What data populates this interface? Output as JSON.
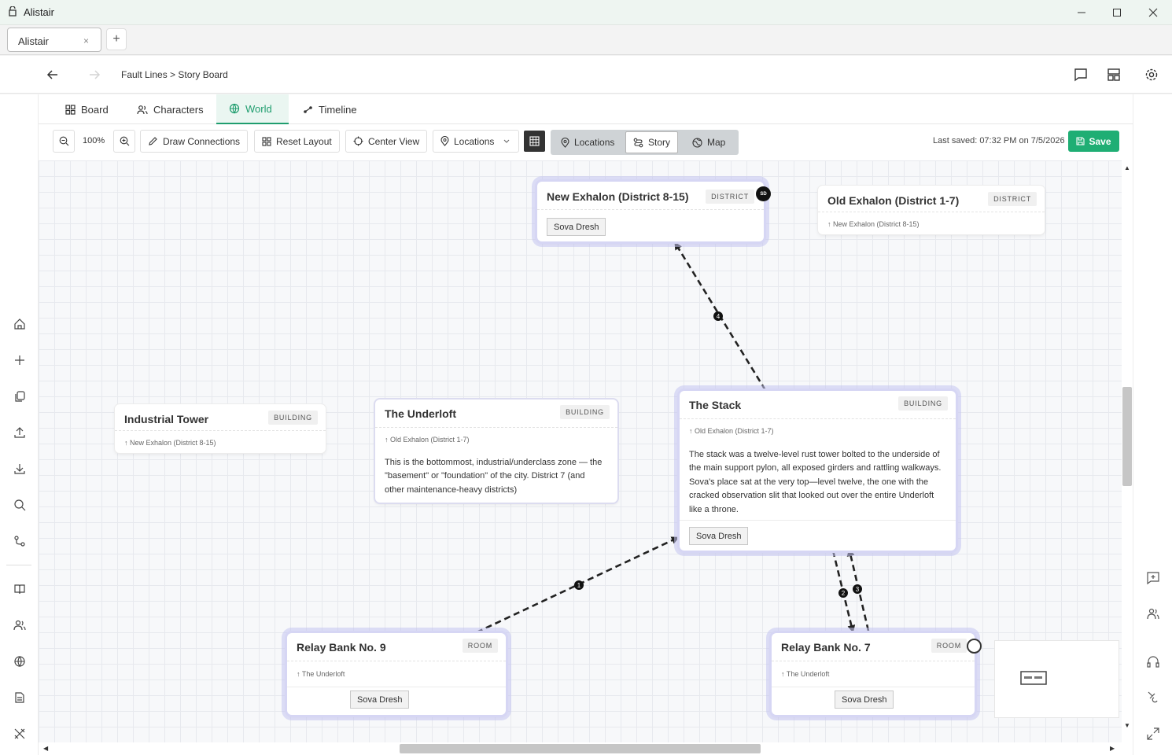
{
  "window": {
    "title": "Alistair"
  },
  "browser_tabs": [
    {
      "label": "Alistair",
      "close": "×"
    }
  ],
  "new_tab_label": "+",
  "breadcrumb": "Fault Lines > Story Board",
  "subtabs": [
    {
      "label": "Board",
      "icon": "grid-icon"
    },
    {
      "label": "Characters",
      "icon": "users-icon"
    },
    {
      "label": "World",
      "icon": "globe-icon",
      "active": true
    },
    {
      "label": "Timeline",
      "icon": "timeline-icon"
    }
  ],
  "toolbar": {
    "zoom": "100%",
    "draw_connections": "Draw Connections",
    "reset_layout": "Reset Layout",
    "center_view": "Center View",
    "locations_dropdown": "Locations",
    "view_modes": [
      {
        "label": "Locations",
        "icon": "pin-icon"
      },
      {
        "label": "Story",
        "icon": "route-icon",
        "active": true
      },
      {
        "label": "Map",
        "icon": "map-icon"
      }
    ],
    "last_saved": "Last saved: 07:32 PM on 7/5/2026",
    "save": "Save"
  },
  "colors": {
    "accent": "#1f9d6e",
    "save": "#1fae74",
    "node_glow": "#d6d6f4"
  },
  "nodes": {
    "new_exhalon": {
      "title": "New Exhalon (District 8-15)",
      "type": "DISTRICT",
      "chip": "Sova Dresh",
      "marker": "SD"
    },
    "old_exhalon": {
      "title": "Old Exhalon (District 1-7)",
      "type": "DISTRICT",
      "parent": "↑ New Exhalon (District 8-15)"
    },
    "industrial_tower": {
      "title": "Industrial Tower",
      "type": "BUILDING",
      "parent": "↑ New Exhalon (District 8-15)"
    },
    "underloft": {
      "title": "The Underloft",
      "type": "BUILDING",
      "parent": "↑ Old Exhalon (District 1-7)",
      "description": "This is the bottommost, industrial/underclass zone — the \"basement\" or \"foundation\" of the city. District 7 (and other maintenance-heavy districts)"
    },
    "stack": {
      "title": "The Stack",
      "type": "BUILDING",
      "parent": "↑ Old Exhalon (District 1-7)",
      "description": "The stack was a twelve-level rust tower bolted to the underside of the main support pylon, all exposed girders and rattling walkways. Sova's place sat at the very top—level twelve, the one with the cracked observation slit that looked out over the entire Underloft like a throne.",
      "chip": "Sova Dresh"
    },
    "relay9": {
      "title": "Relay Bank No. 9",
      "type": "ROOM",
      "parent": "↑ The Underloft",
      "chip": "Sova Dresh"
    },
    "relay7": {
      "title": "Relay Bank No. 7",
      "type": "ROOM",
      "parent": "↑ The Underloft",
      "chip": "Sova Dresh"
    }
  },
  "connections": [
    {
      "number": "1",
      "from": "Relay Bank No. 9",
      "to": "The Stack"
    },
    {
      "number": "2",
      "from": "The Stack",
      "to": "Relay Bank No. 7"
    },
    {
      "number": "3",
      "from": "Relay Bank No. 7",
      "to": "The Stack"
    },
    {
      "number": "4",
      "from": "The Stack",
      "to": "New Exhalon (District 8-15)"
    }
  ]
}
